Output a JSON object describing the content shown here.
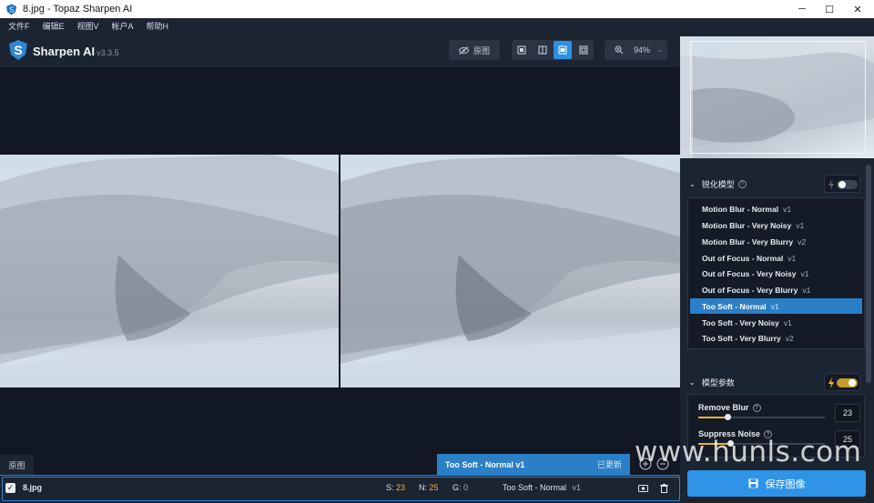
{
  "window": {
    "title": "8.jpg - Topaz Sharpen AI",
    "minimize": "─",
    "maximize": "☐",
    "close": "✕"
  },
  "menu": [
    "文件F",
    "编辑E",
    "视图V",
    "帐户A",
    "帮助H"
  ],
  "app": {
    "name": "Sharpen AI",
    "version": "v3.3.5"
  },
  "toolbar": {
    "original_button": "原图",
    "zoom": "94%"
  },
  "canvas": {
    "original_label": "原图",
    "banner_model": "Too Soft - Normal v1",
    "banner_status": "已更新"
  },
  "filebar": {
    "filename": "8.jpg",
    "s_label": "S:",
    "s_value": "23",
    "n_label": "N:",
    "n_value": "25",
    "g_label": "G:",
    "g_value": "0",
    "model_name": "Too Soft - Normal",
    "model_version": "v1"
  },
  "panel": {
    "models_header": "锐化模型",
    "params_header": "模型参数",
    "models": [
      {
        "name": "Motion Blur - Normal",
        "version": "v1"
      },
      {
        "name": "Motion Blur - Very Noisy",
        "version": "v1"
      },
      {
        "name": "Motion Blur - Very Blurry",
        "version": "v2"
      },
      {
        "name": "Out of Focus - Normal",
        "version": "v1"
      },
      {
        "name": "Out of Focus - Very Noisy",
        "version": "v1"
      },
      {
        "name": "Out of Focus - Very Blurry",
        "version": "v1"
      },
      {
        "name": "Too Soft - Normal",
        "version": "v1"
      },
      {
        "name": "Too Soft - Very Noisy",
        "version": "v1"
      },
      {
        "name": "Too Soft - Very Blurry",
        "version": "v2"
      }
    ],
    "selected_model_index": 6,
    "auto_models_on": false,
    "auto_params_on": true,
    "params": {
      "remove_blur_label": "Remove Blur",
      "remove_blur_value": "23",
      "remove_blur_level": 0.23,
      "suppress_noise_label": "Suppress Noise",
      "suppress_noise_value": "25",
      "suppress_noise_level": 0.25
    },
    "save_button": "保存图像"
  },
  "watermark": "www.hunls.com",
  "colors": {
    "accent": "#2f94e7",
    "selected": "#2b7fc6",
    "yellow": "#f2b531"
  }
}
